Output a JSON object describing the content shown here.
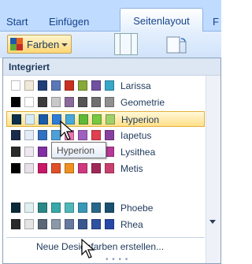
{
  "tabs": [
    "Start",
    "Einfügen",
    "Seitenlayout",
    "F"
  ],
  "active_tab": "Seitenlayout",
  "farben_button": {
    "label": "Farben"
  },
  "gallery": {
    "header": "Integriert",
    "themes": [
      {
        "name": "Larissa",
        "colors": [
          "#ffffff",
          "#f0e8d8",
          "#1f3f78",
          "#5a78b8",
          "#c83020",
          "#88a838",
          "#7050a0",
          "#38a8c8"
        ]
      },
      {
        "name": "Geometrie",
        "colors": [
          "#000000",
          "#ffffff",
          "#3b3b3b",
          "#c8c8c8",
          "#8a6a9a",
          "#555555",
          "#707070",
          "#909090"
        ]
      },
      {
        "name": "Hyperion",
        "colors": [
          "#0e2f4a",
          "#d8ecf8",
          "#1a5ca8",
          "#2f7cd8",
          "#48a8d8",
          "#60b838",
          "#78c840",
          "#a0d068"
        ]
      },
      {
        "name": "Iapetus",
        "colors": [
          "#1a2a4a",
          "#e4ecf8",
          "#3070c0",
          "#50a0d8",
          "#e878b0",
          "#a060c0",
          "#e04050",
          "#8840a0"
        ]
      },
      {
        "name": "Lysithea",
        "colors": [
          "#2a2a2a",
          "#f0e8f0",
          "#8030a0",
          "#c04890",
          "#e870b0",
          "#d03030",
          "#e05080",
          "#b83898"
        ]
      },
      {
        "name": "Metis",
        "colors": [
          "#000000",
          "#e8e0e8",
          "#c81868",
          "#e05028",
          "#f09020",
          "#d03880",
          "#a02858",
          "#c84070"
        ]
      },
      {
        "name": "Phoebe",
        "colors": [
          "#0a2a3a",
          "#e0f0f0",
          "#2a8888",
          "#38a8a8",
          "#50b8b8",
          "#3898b8",
          "#286888",
          "#1a5070"
        ]
      },
      {
        "name": "Rhea",
        "colors": [
          "#2a2a2a",
          "#e4e4e4",
          "#5a6878",
          "#8a98a8",
          "#6878a0",
          "#3a5890",
          "#3050a0",
          "#2848a8"
        ]
      }
    ],
    "selected_theme": "Hyperion",
    "tooltip": "Hyperion",
    "create_new_label": "Neue Designfarben erstellen..."
  }
}
